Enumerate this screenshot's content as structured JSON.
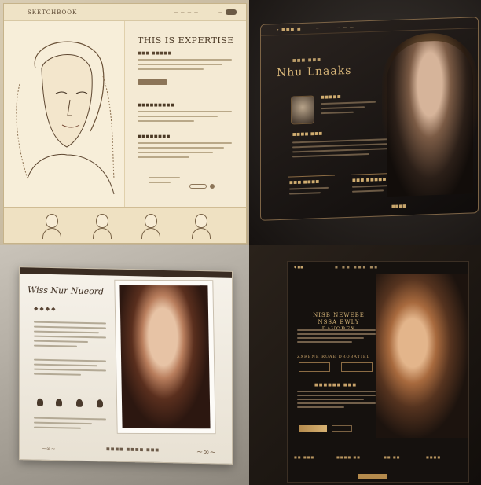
{
  "quadrants": {
    "q1": {
      "brand": "SKETCHBOOK",
      "title": "THIS IS EXPERTISE",
      "nav_a": "— — — —",
      "nav_b": "—",
      "sub": "■■■ ■■■■■",
      "heading_a": "■■■■■■■■■",
      "heading_b": "■■■■■■■■"
    },
    "q2": {
      "brand": "▸ ■■■ ■",
      "nav": "— —   — —   — —",
      "kicker": "■■■ ■■■",
      "title": "Nhu Lnaaks",
      "profile_title": "■■■■■",
      "section_a": "■■■■ ■■■",
      "panel_a": "■■■ ■■■■",
      "panel_b": "■■■ ■■■■■",
      "panel_c": "■■ ■■■■",
      "footer": "■■■■"
    },
    "q3": {
      "title": "Wiss Nur Nueord",
      "diamonds": "◆◆◆◆",
      "footer": "■■■■ ■■■■ ■■■",
      "ornament": "~∞~"
    },
    "q4": {
      "brand": "◆ ■■",
      "nav": "■ ■■ ■■■ ■■",
      "title": "NISB NEWEBE\nNSSA BWLY BAVOBEX",
      "section_a": "ZXRENE  RUAE  DROBATIEL",
      "section_b": "■■■■■■ ■■■",
      "footer_a": "■■ ■■■",
      "footer_b": "■■■■ ■■",
      "footer_c": "■■ ■■",
      "footer_d": "■■■■"
    }
  },
  "colors": {
    "gold": "#c7a56c",
    "sepia": "#5a4630",
    "dark": "#15110e"
  }
}
